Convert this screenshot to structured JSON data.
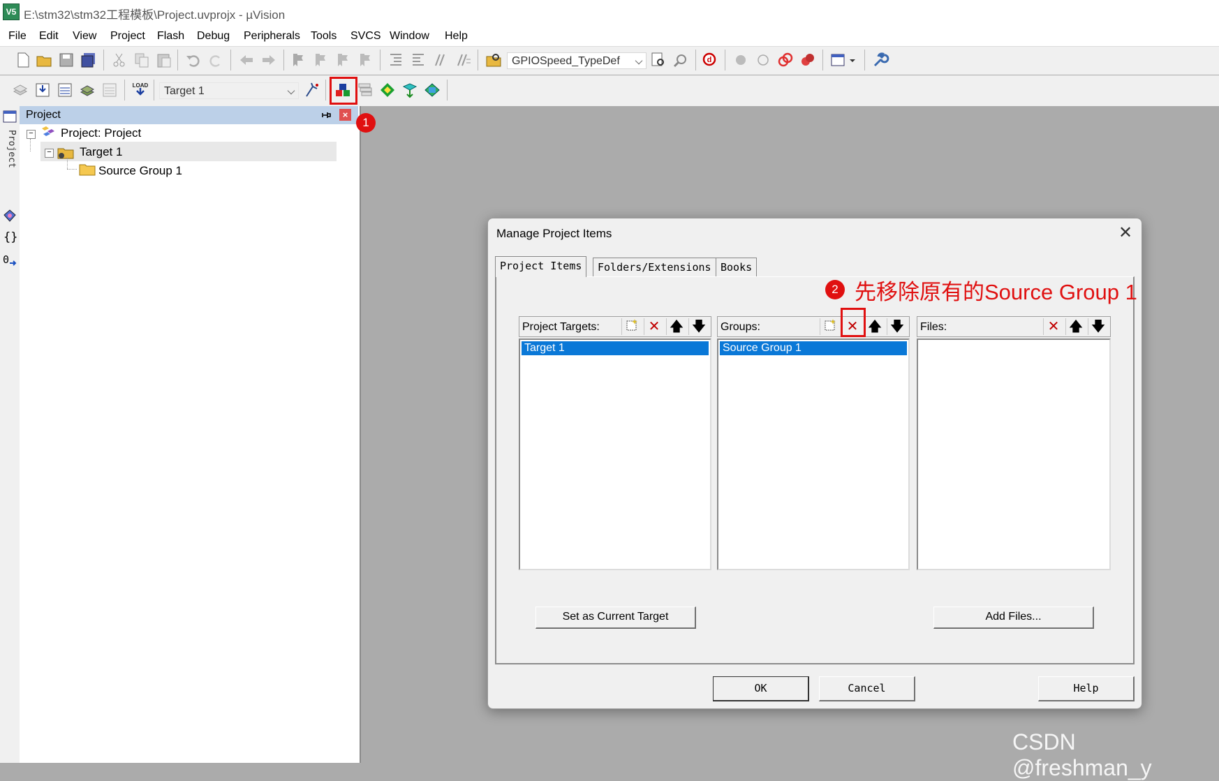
{
  "window": {
    "title": "E:\\stm32\\stm32工程模板\\Project.uvprojx - µVision",
    "icon_label": "V5"
  },
  "menu": [
    "File",
    "Edit",
    "View",
    "Project",
    "Flash",
    "Debug",
    "Peripherals",
    "Tools",
    "SVCS",
    "Window",
    "Help"
  ],
  "toolbar": {
    "find_combo": "GPIOSpeed_TypeDef",
    "target_combo": "Target 1"
  },
  "project_panel": {
    "title": "Project",
    "side_tab": "Project",
    "tree": [
      {
        "label": "Project: Project",
        "level": 0
      },
      {
        "label": "Target 1",
        "level": 1
      },
      {
        "label": "Source Group 1",
        "level": 2
      }
    ]
  },
  "dialog": {
    "title": "Manage Project Items",
    "tabs": [
      "Project Items",
      "Folders/Extensions",
      "Books"
    ],
    "targets": {
      "label": "Project Targets:",
      "items": [
        "Target 1"
      ]
    },
    "groups": {
      "label": "Groups:",
      "items": [
        "Source Group 1"
      ]
    },
    "files": {
      "label": "Files:",
      "items": []
    },
    "set_current_label": "Set as Current Target",
    "add_files_label": "Add Files...",
    "ok_label": "OK",
    "cancel_label": "Cancel",
    "help_label": "Help"
  },
  "annotations": {
    "step1": "1",
    "step2": "2",
    "note": "先移除原有的Source Group 1",
    "color": "#e01010"
  },
  "watermark": "CSDN @freshman_y"
}
